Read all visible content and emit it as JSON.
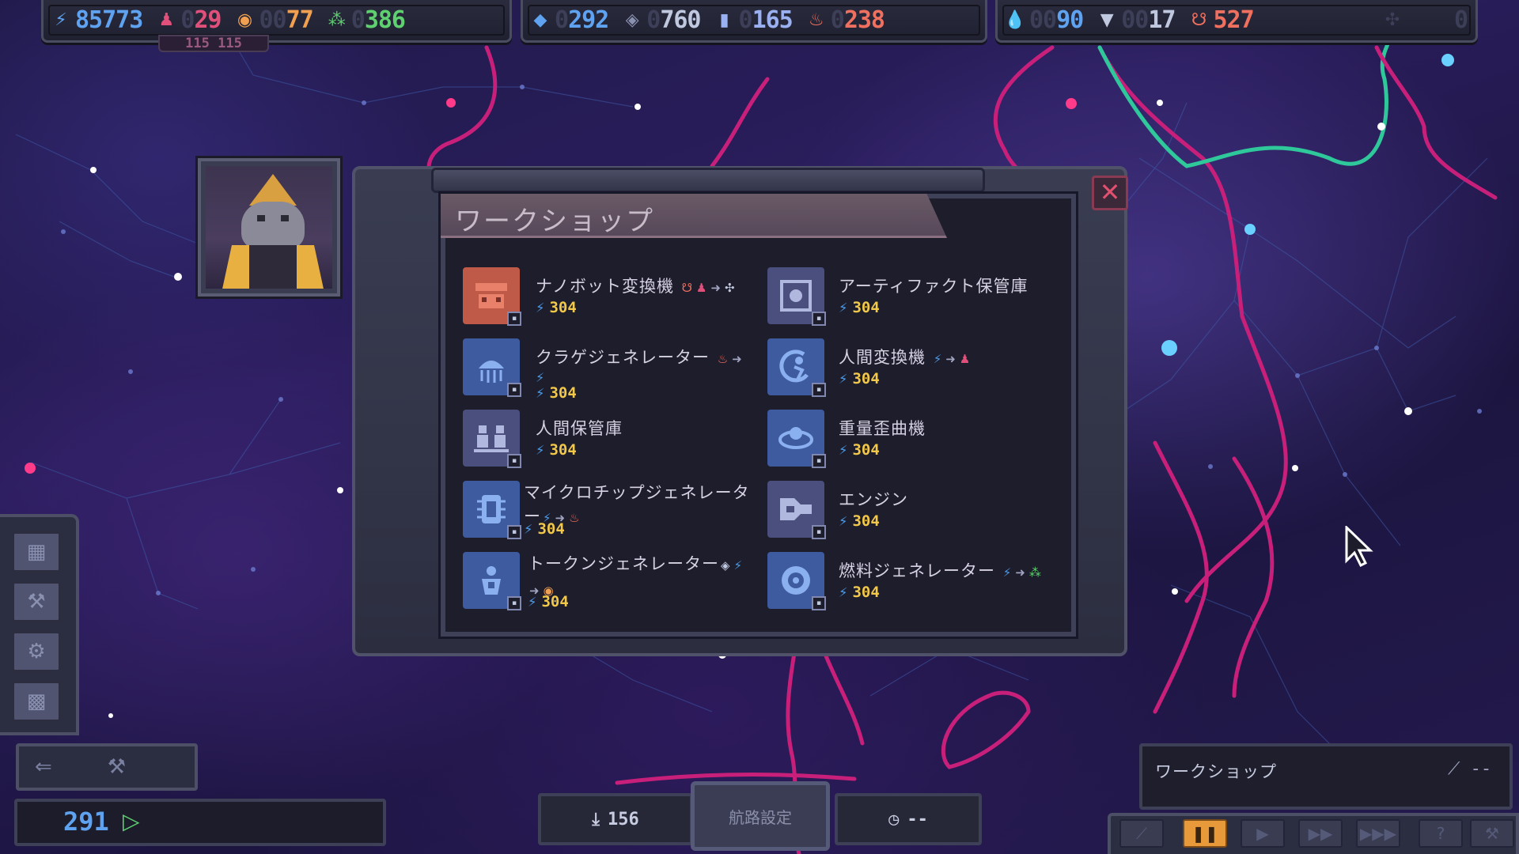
{
  "top_bar": {
    "energy": {
      "icon": "bolt-icon",
      "value": "85773",
      "color": "#5fa2f0"
    },
    "crew": {
      "icon": "crew-icon",
      "dim": "0",
      "value": "29",
      "sub": "115 115",
      "color": "#e0507a"
    },
    "tokens": {
      "icon": "token-icon",
      "dim": "00",
      "value": "77",
      "color": "#f0a050"
    },
    "fuel": {
      "icon": "fuel-icon",
      "dim": "0",
      "value": "386",
      "color": "#5fd070"
    },
    "gems": {
      "icon": "gem-icon",
      "dim": "0",
      "value": "292",
      "color": "#5fa2f0"
    },
    "microchips": {
      "icon": "microchip-icon",
      "dim": "0",
      "value": "760",
      "color": "#c0c8e0"
    },
    "crystals": {
      "icon": "crystal-icon",
      "dim": "0",
      "value": "165",
      "color": "#9ab0f0"
    },
    "jelly": {
      "icon": "jellyfish-icon",
      "dim": "0",
      "value": "238",
      "color": "#f07060"
    },
    "water": {
      "icon": "droplet-icon",
      "dim": "00",
      "value": "90",
      "color": "#5fa2f0"
    },
    "anvil": {
      "icon": "anvil-icon",
      "dim": "00",
      "value": "17",
      "color": "#c0c8e0"
    },
    "beasts": {
      "icon": "beast-icon",
      "dim": "",
      "value": "527",
      "color": "#f07060"
    },
    "unknown": {
      "icon": "cog-icon",
      "value": "0",
      "color": "#3d3e58"
    }
  },
  "panel": {
    "title": "ワークショップ",
    "close": "✕"
  },
  "workshop_items": [
    {
      "name": "ナノボット変換機",
      "cost": "304",
      "icon_color": "#c05a48"
    },
    {
      "name": "アーティファクト保管庫",
      "cost": "304",
      "icon_color": "#4a4f7e"
    },
    {
      "name": "クラゲジェネレーター",
      "cost": "304",
      "icon_color": "#3f5ba0"
    },
    {
      "name": "人間変換機",
      "cost": "304",
      "icon_color": "#3f5ba0"
    },
    {
      "name": "人間保管庫",
      "cost": "304",
      "icon_color": "#4a4f7e"
    },
    {
      "name": "重量歪曲機",
      "cost": "304",
      "icon_color": "#3f5ba0"
    },
    {
      "name": "マイクロチップジェネレーター",
      "cost": "304",
      "icon_color": "#3f5ba0"
    },
    {
      "name": "エンジン",
      "cost": "304",
      "icon_color": "#4a4f7e"
    },
    {
      "name": "トークンジェネレーター",
      "cost": "304",
      "icon_color": "#3f5ba0"
    },
    {
      "name": "燃料ジェネレーター",
      "cost": "304",
      "icon_color": "#3f5ba0"
    }
  ],
  "bottom": {
    "speed": "291",
    "download_count": "156",
    "nav_label": "航路設定",
    "timer": "--",
    "info_label": "ワークショップ",
    "info_right": "--"
  }
}
